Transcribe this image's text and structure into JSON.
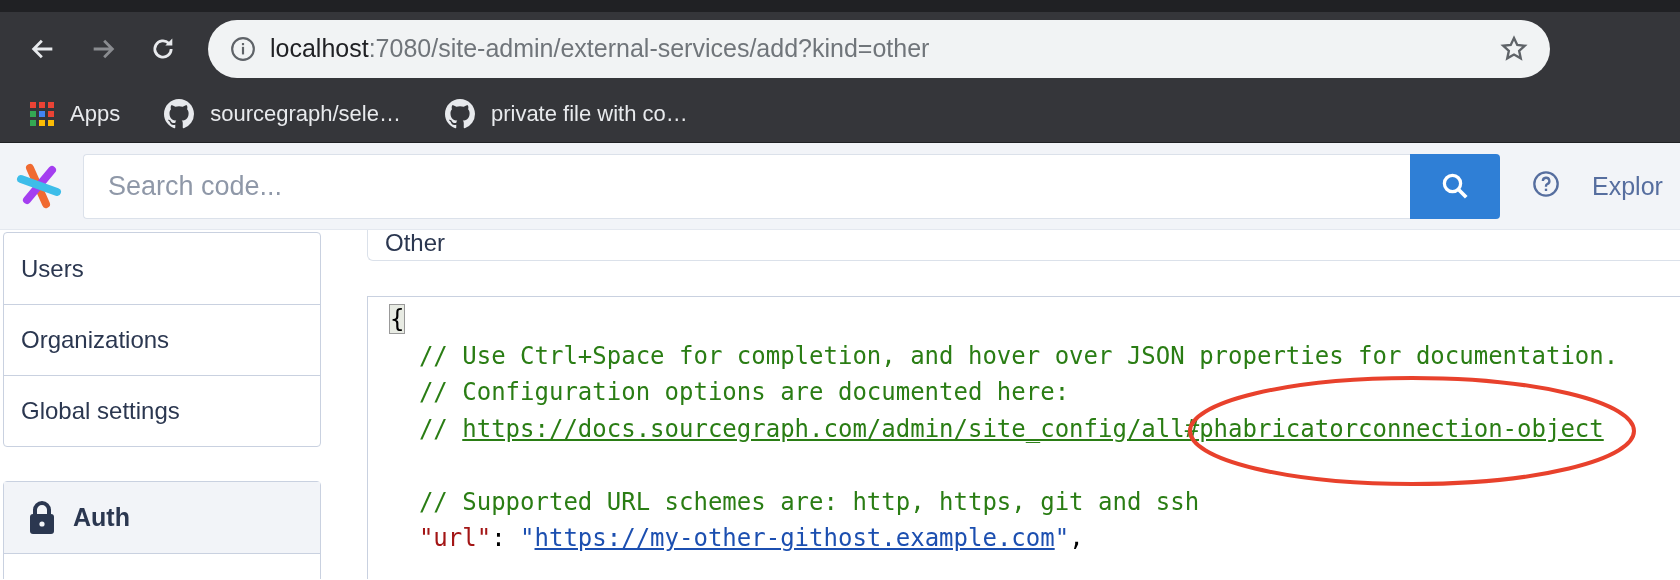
{
  "browser": {
    "address": {
      "host": "localhost",
      "path": ":7080/site-admin/external-services/add?kind=other"
    },
    "bookmarks": [
      {
        "kind": "apps",
        "label": "Apps"
      },
      {
        "kind": "github",
        "label": "sourcegraph/sele…"
      },
      {
        "kind": "github",
        "label": "private file with co…"
      }
    ]
  },
  "header": {
    "search": {
      "placeholder": "Search code..."
    },
    "nav": [
      "Explor"
    ]
  },
  "sidebar": {
    "items": [
      {
        "label": "Users"
      },
      {
        "label": "Organizations"
      },
      {
        "label": "Global settings"
      }
    ],
    "section": {
      "title": "Auth"
    }
  },
  "kind_card": {
    "label": "Other"
  },
  "editor": {
    "lines": [
      {
        "kind": "code",
        "tokens": [
          {
            "kind": "matched-bracket",
            "text": "{"
          }
        ]
      },
      {
        "kind": "code",
        "tokens": [
          {
            "kind": "comment",
            "text": "  // Use Ctrl+Space for completion, and hover over JSON properties for documentation."
          }
        ]
      },
      {
        "kind": "code",
        "tokens": [
          {
            "kind": "comment",
            "text": "  // Configuration options are documented here:"
          }
        ]
      },
      {
        "kind": "code",
        "tokens": [
          {
            "kind": "comment",
            "text": "  // "
          },
          {
            "kind": "comment-link",
            "text": "https://docs.sourcegraph.com/admin/site_config/all#phabricatorconnection-object"
          }
        ]
      },
      {
        "kind": "blank"
      },
      {
        "kind": "code",
        "tokens": [
          {
            "kind": "comment",
            "text": "  // Supported URL schemes are: http, https, git and ssh"
          }
        ]
      },
      {
        "kind": "code",
        "tokens": [
          {
            "kind": "key",
            "text": "  \"url\""
          },
          {
            "kind": "punct",
            "text": ": "
          },
          {
            "kind": "string",
            "text": "\""
          },
          {
            "kind": "string-link",
            "text": "https://my-other-githost.example.com"
          },
          {
            "kind": "string",
            "text": "\""
          },
          {
            "kind": "punct",
            "text": ","
          }
        ]
      }
    ]
  }
}
